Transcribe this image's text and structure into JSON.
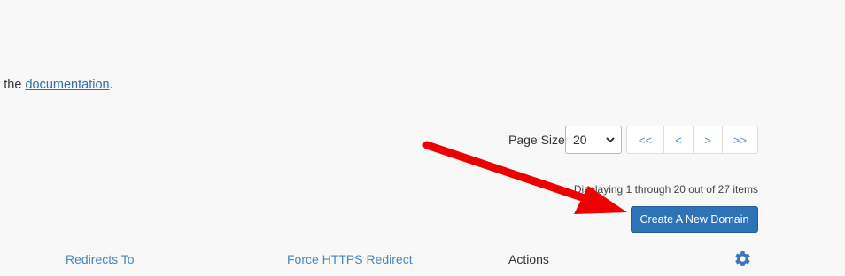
{
  "intro": {
    "prefix": "l the",
    "link": "documentation",
    "suffix": "."
  },
  "pagination": {
    "page_size_label": "Page Size",
    "page_size_value": "20",
    "first": "<<",
    "prev": "<",
    "next": ">",
    "last": ">>"
  },
  "display_info": "Displaying 1 through 20 out of 27 items",
  "create_button": "Create A New Domain",
  "table": {
    "columns": [
      "Redirects To",
      "Force HTTPS Redirect",
      "Actions"
    ]
  },
  "icons": {
    "settings": "gear-icon",
    "select": "chevron-down-icon",
    "annotation": "red-arrow"
  },
  "colors": {
    "primary_button": "#2e72b8",
    "link": "#2f6fae",
    "annotation_arrow": "#ee0000"
  }
}
